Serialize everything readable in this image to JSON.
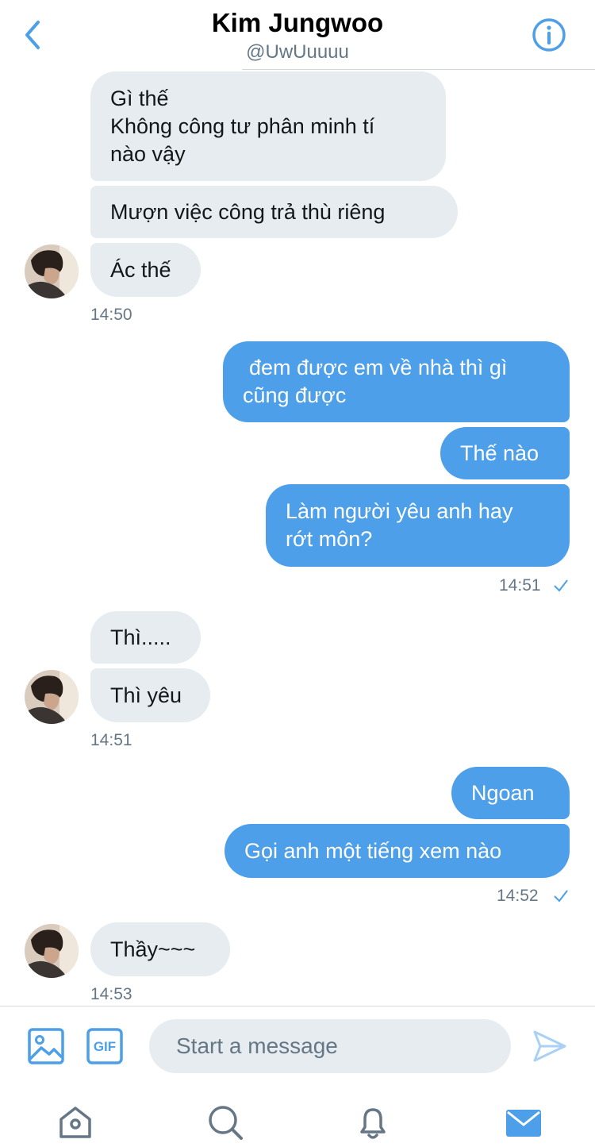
{
  "header": {
    "title": "Kim Jungwoo",
    "handle": "@UwUuuuu",
    "back_icon": "chevron-left-icon",
    "info_icon": "info-icon"
  },
  "colors": {
    "accent": "#4c9fe8",
    "received_bubble": "#e6ecf0",
    "timestamp": "#657786"
  },
  "messages": {
    "m1_line1": "Gì thế",
    "m1_line2": "Không công tư phân minh tí",
    "m1_line3": "nào vậy",
    "m2": "Mượn việc công trả thù riêng",
    "m3": "Ác thế",
    "t1": "14:50",
    "m4_line1": "đem được em về nhà thì gì",
    "m4_line2": "cũng được",
    "m5": "Thế nào",
    "m6_line1": "Làm người yêu anh hay",
    "m6_line2": "rớt môn?",
    "t2": "14:51",
    "m7": "Thì.....",
    "m8": "Thì yêu",
    "t3": "14:51",
    "m9": "Ngoan",
    "m10": "Gọi anh một tiếng xem nào",
    "t4": "14:52",
    "m11": "Thầy~~~",
    "t5": "14:53"
  },
  "composer": {
    "placeholder": "Start a message",
    "gif_label": "GIF",
    "image_icon": "image-icon",
    "send_icon": "send-icon"
  },
  "tabs": [
    "home-icon",
    "search-icon",
    "notifications-icon",
    "messages-icon"
  ]
}
